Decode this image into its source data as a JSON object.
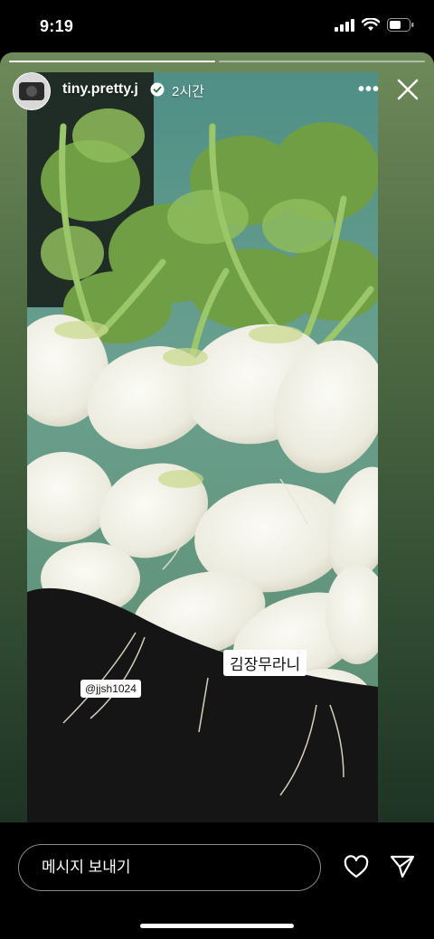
{
  "status_bar": {
    "time": "9:19"
  },
  "story": {
    "progress_segments": 2,
    "active_segment": 0,
    "username": "tiny.pretty.j",
    "time_ago": "2시간",
    "photo_subject": "white radishes with green leaves",
    "stickers": {
      "mention": "@jjsh1024",
      "caption": "김장무라니"
    }
  },
  "footer": {
    "message_placeholder": "메시지 보내기"
  }
}
